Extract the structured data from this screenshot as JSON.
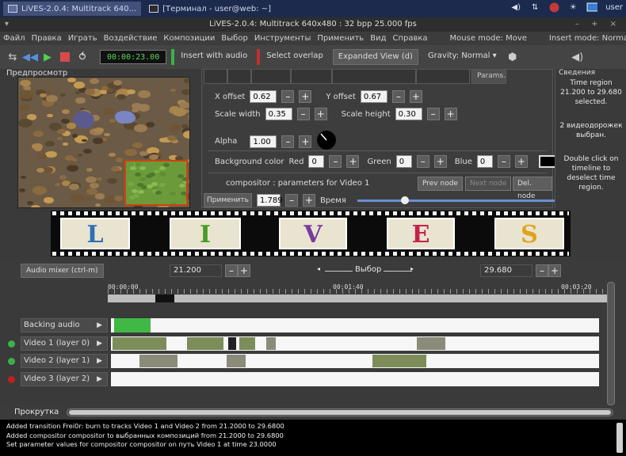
{
  "taskbar": {
    "task1": "LiVES-2.0.4: Multitrack 640...",
    "task2": "[Терминал - user@web: ~]",
    "user": "user"
  },
  "window": {
    "title": "LiVES-2.0.4: Multitrack 640x480 : 32 bpp 25.000 fps",
    "controls": "– + ×"
  },
  "menu": {
    "items": [
      "Файл",
      "Правка",
      "Играть",
      "Воздействие",
      "Композиции",
      "Выбор",
      "Инструменты",
      "Применить",
      "Вид",
      "Справка"
    ],
    "mouse_mode": "Mouse mode: Move",
    "insert_mode": "Insert mode: Normal"
  },
  "toolbar": {
    "timecode": "00:00:23.00",
    "insert_with_audio": "Insert with audio",
    "select_overlap": "Select overlap",
    "expanded_view": "Expanded View (d)",
    "gravity": "Gravity: Normal",
    "gravity_arrow": "▾"
  },
  "preview": {
    "label": "Предпросмотр"
  },
  "params": {
    "tab_label": "Params.",
    "x_offset_label": "X offset",
    "x_offset": "0.62",
    "y_offset_label": "Y offset",
    "y_offset": "0.67",
    "scale_width_label": "Scale width",
    "scale_width": "0.35",
    "scale_height_label": "Scale height",
    "scale_height": "0.30",
    "alpha_label": "Alpha",
    "alpha": "1.00",
    "bg_color_label": "Background color",
    "red_label": "Red",
    "red": "0",
    "green_label": "Green",
    "green": "0",
    "blue_label": "Blue",
    "blue": "0",
    "minus": "–",
    "plus": "+",
    "compositor_text": "compositor : parameters for Video 1",
    "prev_node": "Prev node",
    "next_node": "Next node",
    "del_node": "Del. node",
    "apply": "Применить",
    "time_value": "1.789",
    "time_label": "Время",
    "time_slider_fraction": 0.23
  },
  "info": {
    "title": "Сведения",
    "region": "Time region 21.200 to 29.680 selected.",
    "tracks": "2 видеодорожек выбран.",
    "hint": "Double click on timeline to deselect time region."
  },
  "filmstrip": {
    "letters": [
      "L",
      "I",
      "V",
      "E",
      "S"
    ],
    "colors": [
      "#2f6fb5",
      "#4a9a2a",
      "#7a3aa0",
      "#c4234e",
      "#e0a21a"
    ]
  },
  "timeline": {
    "audio_mixer": "Audio mixer (ctrl-m)",
    "start_time": "21.200",
    "selection_label": "Выбор",
    "end_time": "29.680",
    "ruler_labels": [
      "00:00:00",
      "00:01:40",
      "00:03:20"
    ],
    "tracks": [
      {
        "name": "Backing audio",
        "dot_color": ""
      },
      {
        "name": "Video 1 (layer 0)",
        "dot_color": "#3ab14a"
      },
      {
        "name": "Video 2 (layer 1)",
        "dot_color": "#3ab14a"
      },
      {
        "name": "Video 3 (layer 2)",
        "dot_color": "#c0201a"
      }
    ],
    "scroll_label": "Прокрутка"
  },
  "log": {
    "lines": [
      "Added transition Frei0r: burn to tracks Video 1 and Video 2 from 21.2000 to 29.6800",
      "Added compositor compositor to выбранных композиций from 21.2000 to 29.6800",
      "Set parameter values for compositor compositor on путь Video 1 at time 23.0000"
    ]
  }
}
